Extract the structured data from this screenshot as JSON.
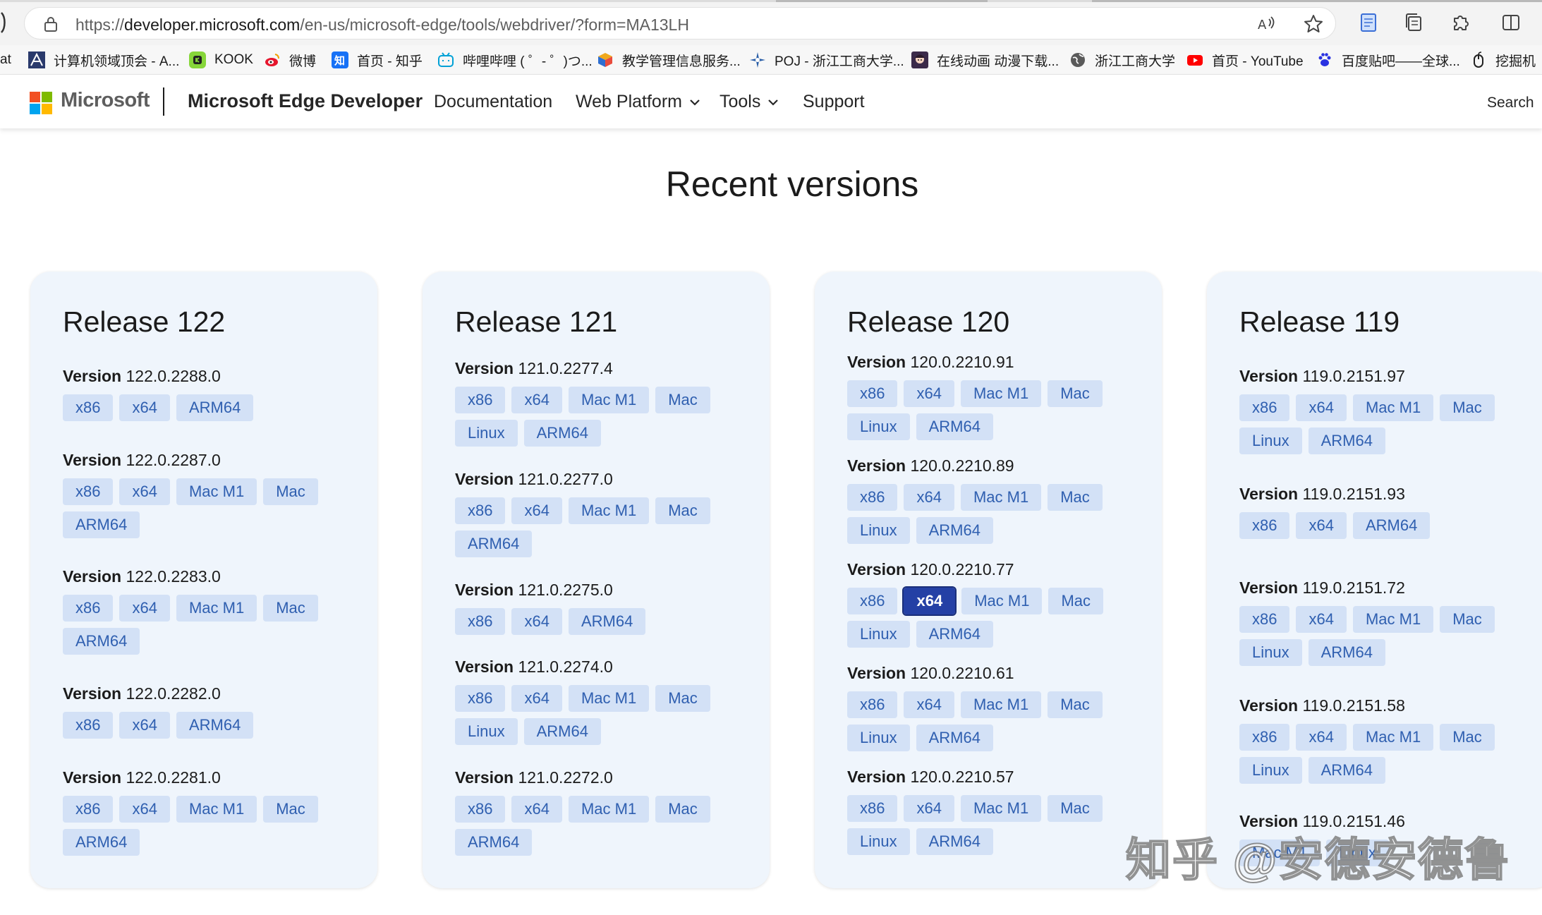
{
  "browser": {
    "url_prefix": "https://",
    "url_domain": "developer.microsoft.com",
    "url_path": "/en-us/microsoft-edge/tools/webdriver/?form=MA13LH"
  },
  "favorites": [
    {
      "label": "at",
      "icon": "none"
    },
    {
      "label": "计算机领域顶会 - A...",
      "icon": "ai-logo-icon"
    },
    {
      "label": "KOOK",
      "icon": "kook-icon"
    },
    {
      "label": "微博",
      "icon": "weibo-icon"
    },
    {
      "label": "首页 - 知乎",
      "icon": "zhihu-icon"
    },
    {
      "label": "哔哩哔哩 ( ゜- ゜)つ...",
      "icon": "bilibili-icon"
    },
    {
      "label": "教学管理信息服务...",
      "icon": "cube-icon"
    },
    {
      "label": "POJ - 浙江工商大学...",
      "icon": "compass-icon"
    },
    {
      "label": "在线动画 动漫下载...",
      "icon": "anime-icon"
    },
    {
      "label": "浙江工商大学",
      "icon": "globe-icon"
    },
    {
      "label": "首页 - YouTube",
      "icon": "youtube-icon"
    },
    {
      "label": "百度贴吧——全球...",
      "icon": "baidu-icon"
    },
    {
      "label": "挖掘机",
      "icon": "mouse-icon"
    }
  ],
  "header": {
    "brand": "Microsoft",
    "site_title": "Microsoft Edge Developer",
    "nav": [
      "Documentation",
      "Web Platform",
      "Tools",
      "Support"
    ],
    "search": "Search"
  },
  "section_title": "Recent versions",
  "version_word": "Version",
  "releases": [
    {
      "title": "Release 122",
      "versions": [
        {
          "number": "122.0.2288.0",
          "builds": [
            "x86",
            "x64",
            "ARM64"
          ]
        },
        {
          "number": "122.0.2287.0",
          "builds": [
            "x86",
            "x64",
            "Mac M1",
            "Mac",
            "ARM64"
          ]
        },
        {
          "number": "122.0.2283.0",
          "builds": [
            "x86",
            "x64",
            "Mac M1",
            "Mac",
            "ARM64"
          ]
        },
        {
          "number": "122.0.2282.0",
          "builds": [
            "x86",
            "x64",
            "ARM64"
          ]
        },
        {
          "number": "122.0.2281.0",
          "builds": [
            "x86",
            "x64",
            "Mac M1",
            "Mac",
            "ARM64"
          ]
        }
      ]
    },
    {
      "title": "Release 121",
      "versions": [
        {
          "number": "121.0.2277.4",
          "builds": [
            "x86",
            "x64",
            "Mac M1",
            "Mac",
            "Linux",
            "ARM64"
          ]
        },
        {
          "number": "121.0.2277.0",
          "builds": [
            "x86",
            "x64",
            "Mac M1",
            "Mac",
            "ARM64"
          ]
        },
        {
          "number": "121.0.2275.0",
          "builds": [
            "x86",
            "x64",
            "ARM64"
          ]
        },
        {
          "number": "121.0.2274.0",
          "builds": [
            "x86",
            "x64",
            "Mac M1",
            "Mac",
            "Linux",
            "ARM64"
          ]
        },
        {
          "number": "121.0.2272.0",
          "builds": [
            "x86",
            "x64",
            "Mac M1",
            "Mac",
            "ARM64"
          ]
        }
      ]
    },
    {
      "title": "Release 120",
      "versions": [
        {
          "number": "120.0.2210.91",
          "builds": [
            "x86",
            "x64",
            "Mac M1",
            "Mac",
            "Linux",
            "ARM64"
          ]
        },
        {
          "number": "120.0.2210.89",
          "builds": [
            "x86",
            "x64",
            "Mac M1",
            "Mac",
            "Linux",
            "ARM64"
          ]
        },
        {
          "number": "120.0.2210.77",
          "builds": [
            "x86",
            "x64",
            "Mac M1",
            "Mac",
            "Linux",
            "ARM64"
          ],
          "selected": "x64"
        },
        {
          "number": "120.0.2210.61",
          "builds": [
            "x86",
            "x64",
            "Mac M1",
            "Mac",
            "Linux",
            "ARM64"
          ]
        },
        {
          "number": "120.0.2210.57",
          "builds": [
            "x86",
            "x64",
            "Mac M1",
            "Mac",
            "Linux",
            "ARM64"
          ]
        }
      ]
    },
    {
      "title": "Release 119",
      "versions": [
        {
          "number": "119.0.2151.97",
          "builds": [
            "x86",
            "x64",
            "Mac M1",
            "Mac",
            "Linux",
            "ARM64"
          ]
        },
        {
          "number": "119.0.2151.93",
          "builds": [
            "x86",
            "x64",
            "ARM64"
          ]
        },
        {
          "number": "119.0.2151.72",
          "builds": [
            "x86",
            "x64",
            "Mac M1",
            "Mac",
            "Linux",
            "ARM64"
          ]
        },
        {
          "number": "119.0.2151.58",
          "builds": [
            "x86",
            "x64",
            "Mac M1",
            "Mac",
            "Linux",
            "ARM64"
          ]
        },
        {
          "number": "119.0.2151.46",
          "builds": [
            "Mac M1",
            "Linux"
          ]
        }
      ]
    }
  ],
  "watermark": "知乎 @安德安德鲁",
  "colors": {
    "chip_bg": "#d3e1f6",
    "chip_text": "#2f5fb0",
    "chip_active_bg": "#2440a5",
    "card_bg": "#eff5fc",
    "ms_red": "#f25022",
    "ms_green": "#7fba00",
    "ms_blue": "#00a4ef",
    "ms_yellow": "#ffb900"
  }
}
